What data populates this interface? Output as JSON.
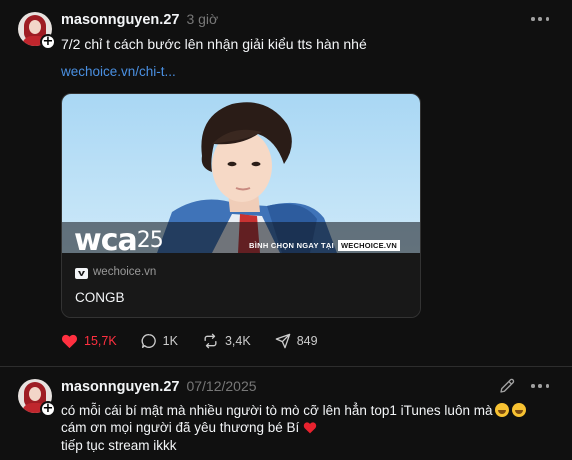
{
  "posts": [
    {
      "username": "masonnguyen.27",
      "timestamp": "3 giờ",
      "text": "7/2 chỉ t cách bước lên nhận giải kiểu tts hàn nhé",
      "link": "wechoice.vn/chi-t...",
      "card": {
        "brand": "wca",
        "brand_number": "25",
        "vote_label": "BÌNH CHỌN NGAY TẠI",
        "vote_site": "WECHOICE.VN",
        "site_name": "wechoice.vn",
        "title": "CONGB"
      },
      "actions": {
        "likes": "15,7K",
        "comments": "1K",
        "reposts": "3,4K",
        "shares": "849"
      }
    },
    {
      "username": "masonnguyen.27",
      "timestamp": "07/12/2025",
      "lines": [
        "có mỗi cái bí mật mà nhiều người tò mò cỡ lên hẳn top1 iTunes luôn mà",
        "cám ơn mọi người đã yêu thương bé Bí",
        "tiếp tục stream ikkk"
      ]
    }
  ],
  "colors": {
    "background": "#101010",
    "link": "#4a90e2",
    "like_active": "#ff3040",
    "muted": "#777777"
  },
  "icons": [
    "plus-icon",
    "more-icon",
    "heart-icon",
    "comment-icon",
    "repost-icon",
    "share-icon",
    "edit-icon",
    "wechoice-logo-icon"
  ]
}
